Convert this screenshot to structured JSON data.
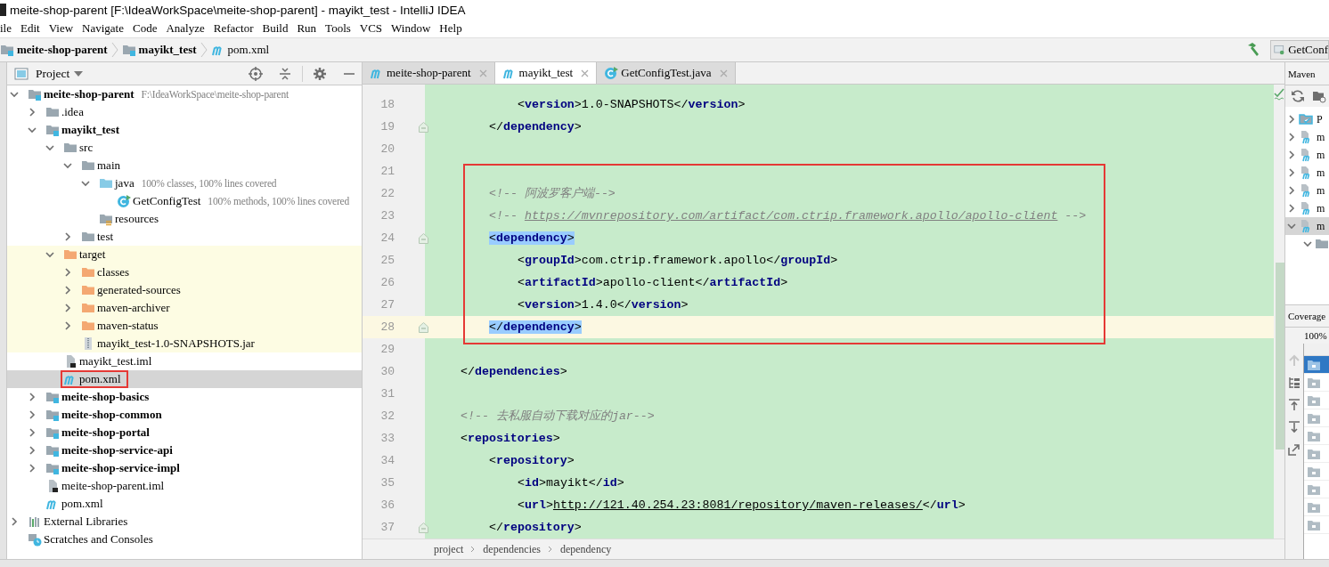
{
  "window": {
    "title": "meite-shop-parent [F:\\IdeaWorkSpace\\meite-shop-parent] - mayikt_test - IntelliJ IDEA"
  },
  "menu": [
    "ile",
    "Edit",
    "View",
    "Navigate",
    "Code",
    "Analyze",
    "Refactor",
    "Build",
    "Run",
    "Tools",
    "VCS",
    "Window",
    "Help"
  ],
  "navigation": {
    "breadcrumbs": [
      {
        "label": "meite-shop-parent",
        "kind": "module"
      },
      {
        "label": "mayikt_test",
        "kind": "module"
      },
      {
        "label": "pom.xml",
        "kind": "maven"
      }
    ],
    "run_config": "GetConf"
  },
  "project_panel": {
    "title": "Project",
    "tree": [
      {
        "label": "meite-shop-parent",
        "kind": "module",
        "note": "F:\\IdeaWorkSpace\\meite-shop-parent",
        "expanded": true,
        "selected": false,
        "children": [
          {
            "label": ".idea",
            "kind": "folder",
            "expanded": false,
            "selected": false
          },
          {
            "label": "mayikt_test",
            "kind": "module",
            "expanded": true,
            "selected": false,
            "children": [
              {
                "label": "src",
                "kind": "folder",
                "expanded": true,
                "selected": false,
                "children": [
                  {
                    "label": "main",
                    "kind": "folder",
                    "expanded": true,
                    "selected": false,
                    "children": [
                      {
                        "label": "java",
                        "kind": "source-folder",
                        "note": "100% classes, 100% lines covered",
                        "expanded": true,
                        "selected": false,
                        "children": [
                          {
                            "label": "GetConfigTest",
                            "kind": "java-class",
                            "note": "100% methods, 100% lines covered",
                            "selected": false
                          }
                        ]
                      },
                      {
                        "label": "resources",
                        "kind": "resources",
                        "selected": false
                      }
                    ]
                  },
                  {
                    "label": "test",
                    "kind": "folder",
                    "expanded": false,
                    "selected": false
                  }
                ]
              },
              {
                "label": "target",
                "kind": "excluded-folder",
                "excluded": true,
                "expanded": true,
                "selected": false,
                "children": [
                  {
                    "label": "classes",
                    "kind": "excluded-folder",
                    "expanded": false,
                    "selected": false
                  },
                  {
                    "label": "generated-sources",
                    "kind": "excluded-folder",
                    "expanded": false,
                    "selected": false
                  },
                  {
                    "label": "maven-archiver",
                    "kind": "excluded-folder",
                    "expanded": false,
                    "selected": false
                  },
                  {
                    "label": "maven-status",
                    "kind": "excluded-folder",
                    "expanded": false,
                    "selected": false
                  },
                  {
                    "label": "mayikt_test-1.0-SNAPSHOTS.jar",
                    "kind": "jar",
                    "selected": false
                  }
                ]
              },
              {
                "label": "mayikt_test.iml",
                "kind": "iml",
                "selected": false
              },
              {
                "label": "pom.xml",
                "kind": "maven",
                "selected": true,
                "framed": true
              }
            ]
          },
          {
            "label": "meite-shop-basics",
            "kind": "module",
            "expanded": false,
            "selected": false
          },
          {
            "label": "meite-shop-common",
            "kind": "module",
            "expanded": false,
            "selected": false
          },
          {
            "label": "meite-shop-portal",
            "kind": "module",
            "expanded": false,
            "selected": false
          },
          {
            "label": "meite-shop-service-api",
            "kind": "module",
            "expanded": false,
            "selected": false
          },
          {
            "label": "meite-shop-service-impl",
            "kind": "module",
            "expanded": false,
            "selected": false
          },
          {
            "label": "meite-shop-parent.iml",
            "kind": "iml",
            "selected": false
          },
          {
            "label": "pom.xml",
            "kind": "maven",
            "selected": false
          }
        ]
      },
      {
        "label": "External Libraries",
        "kind": "libraries",
        "expanded": false,
        "selected": false
      },
      {
        "label": "Scratches and Consoles",
        "kind": "scratches",
        "selected": false
      }
    ]
  },
  "editor": {
    "tabs": [
      {
        "label": "meite-shop-parent",
        "kind": "maven",
        "selected": false
      },
      {
        "label": "mayikt_test",
        "kind": "maven",
        "selected": true
      },
      {
        "label": "GetConfigTest.java",
        "kind": "java-class",
        "selected": false
      }
    ],
    "lines": [
      {
        "number": "18",
        "parts": [
          {
            "text": "            <",
            "kind": "bracket"
          },
          {
            "text": "version",
            "kind": "name"
          },
          {
            "text": ">",
            "kind": "bracket"
          },
          {
            "text": "1.0-SNAPSHOTS",
            "kind": "text"
          },
          {
            "text": "</",
            "kind": "bracket"
          },
          {
            "text": "version",
            "kind": "name"
          },
          {
            "text": ">",
            "kind": "bracket"
          }
        ]
      },
      {
        "number": "19",
        "fold": true,
        "parts": [
          {
            "text": "        </",
            "kind": "bracket"
          },
          {
            "text": "dependency",
            "kind": "name"
          },
          {
            "text": ">",
            "kind": "bracket"
          }
        ]
      },
      {
        "number": "20"
      },
      {
        "number": "21"
      },
      {
        "number": "22",
        "parts": [
          {
            "text": "        <!-- 阿波罗客户端-->",
            "kind": "comment"
          }
        ]
      },
      {
        "number": "23",
        "parts": [
          {
            "text": "        <!-- ",
            "kind": "comment"
          },
          {
            "text": "https://mvnrepository.com/artifact/com.ctrip.framework.apollo/apollo-client",
            "kind": "comment-link"
          },
          {
            "text": " -->",
            "kind": "comment"
          }
        ]
      },
      {
        "number": "24",
        "fold": true,
        "parts": [
          {
            "text": "        <",
            "kind": "bracket",
            "matched": true
          },
          {
            "text": "dependency",
            "kind": "name",
            "matched": true
          },
          {
            "text": ">",
            "kind": "bracket",
            "matched": true
          }
        ]
      },
      {
        "number": "25",
        "parts": [
          {
            "text": "            <",
            "kind": "bracket"
          },
          {
            "text": "groupId",
            "kind": "name"
          },
          {
            "text": ">",
            "kind": "bracket"
          },
          {
            "text": "com.ctrip.framework.apollo",
            "kind": "text"
          },
          {
            "text": "</",
            "kind": "bracket"
          },
          {
            "text": "groupId",
            "kind": "name"
          },
          {
            "text": ">",
            "kind": "bracket"
          }
        ]
      },
      {
        "number": "26",
        "parts": [
          {
            "text": "            <",
            "kind": "bracket"
          },
          {
            "text": "artifactId",
            "kind": "name"
          },
          {
            "text": ">",
            "kind": "bracket"
          },
          {
            "text": "apollo-client",
            "kind": "text"
          },
          {
            "text": "</",
            "kind": "bracket"
          },
          {
            "text": "artifactId",
            "kind": "name"
          },
          {
            "text": ">",
            "kind": "bracket"
          }
        ]
      },
      {
        "number": "27",
        "parts": [
          {
            "text": "            <",
            "kind": "bracket"
          },
          {
            "text": "version",
            "kind": "name"
          },
          {
            "text": ">",
            "kind": "bracket"
          },
          {
            "text": "1.4.0",
            "kind": "text"
          },
          {
            "text": "</",
            "kind": "bracket"
          },
          {
            "text": "version",
            "kind": "name"
          },
          {
            "text": ">",
            "kind": "bracket"
          }
        ]
      },
      {
        "number": "28",
        "current": true,
        "fold": true,
        "parts": [
          {
            "text": "        </",
            "kind": "bracket",
            "matched": true
          },
          {
            "text": "dependency",
            "kind": "name",
            "matched": true
          },
          {
            "text": ">",
            "kind": "bracket",
            "matched": true
          }
        ]
      },
      {
        "number": "29"
      },
      {
        "number": "30",
        "parts": [
          {
            "text": "    </",
            "kind": "bracket"
          },
          {
            "text": "dependencies",
            "kind": "name"
          },
          {
            "text": ">",
            "kind": "bracket"
          }
        ]
      },
      {
        "number": "31"
      },
      {
        "number": "32",
        "parts": [
          {
            "text": "    <!-- 去私服自动下载对应的jar-->",
            "kind": "comment"
          }
        ]
      },
      {
        "number": "33",
        "parts": [
          {
            "text": "    <",
            "kind": "bracket"
          },
          {
            "text": "repositories",
            "kind": "name"
          },
          {
            "text": ">",
            "kind": "bracket"
          }
        ]
      },
      {
        "number": "34",
        "parts": [
          {
            "text": "        <",
            "kind": "bracket"
          },
          {
            "text": "repository",
            "kind": "name"
          },
          {
            "text": ">",
            "kind": "bracket"
          }
        ]
      },
      {
        "number": "35",
        "parts": [
          {
            "text": "            <",
            "kind": "bracket"
          },
          {
            "text": "id",
            "kind": "name"
          },
          {
            "text": ">",
            "kind": "bracket"
          },
          {
            "text": "mayikt",
            "kind": "text"
          },
          {
            "text": "</",
            "kind": "bracket"
          },
          {
            "text": "id",
            "kind": "name"
          },
          {
            "text": ">",
            "kind": "bracket"
          }
        ]
      },
      {
        "number": "36",
        "parts": [
          {
            "text": "            <",
            "kind": "bracket"
          },
          {
            "text": "url",
            "kind": "name"
          },
          {
            "text": ">",
            "kind": "bracket"
          },
          {
            "text": "http://121.40.254.23:8081/repository/maven-releases/",
            "kind": "link"
          },
          {
            "text": "</",
            "kind": "bracket"
          },
          {
            "text": "url",
            "kind": "name"
          },
          {
            "text": ">",
            "kind": "bracket"
          }
        ]
      },
      {
        "number": "37",
        "fold": true,
        "parts": [
          {
            "text": "        </",
            "kind": "bracket"
          },
          {
            "text": "repository",
            "kind": "name"
          },
          {
            "text": ">",
            "kind": "bracket"
          }
        ]
      }
    ],
    "breadcrumbs": [
      "project",
      "dependencies",
      "dependency"
    ]
  },
  "maven_panel": {
    "title": "Maven",
    "items": [
      {
        "label": "P",
        "kind": "profiles",
        "expanded": false,
        "selected": false
      },
      {
        "label": "m",
        "kind": "maven",
        "expanded": false,
        "selected": false
      },
      {
        "label": "m",
        "kind": "maven",
        "expanded": false,
        "selected": false
      },
      {
        "label": "m",
        "kind": "maven",
        "expanded": false,
        "selected": false
      },
      {
        "label": "m",
        "kind": "maven",
        "expanded": false,
        "selected": false
      },
      {
        "label": "m",
        "kind": "maven",
        "expanded": false,
        "selected": false
      },
      {
        "label": "m",
        "kind": "maven",
        "expanded": true,
        "selected": true,
        "children": [
          {
            "kind": "folder",
            "expanded": true,
            "selected": false
          }
        ]
      }
    ]
  },
  "coverage_panel": {
    "title": "Coverage",
    "summary": "100%",
    "rows": [
      {
        "selected": true
      },
      {
        "selected": false
      },
      {
        "selected": false
      },
      {
        "selected": false
      },
      {
        "selected": false
      },
      {
        "selected": false
      },
      {
        "selected": false
      },
      {
        "selected": false
      },
      {
        "selected": false
      },
      {
        "selected": false
      }
    ]
  }
}
